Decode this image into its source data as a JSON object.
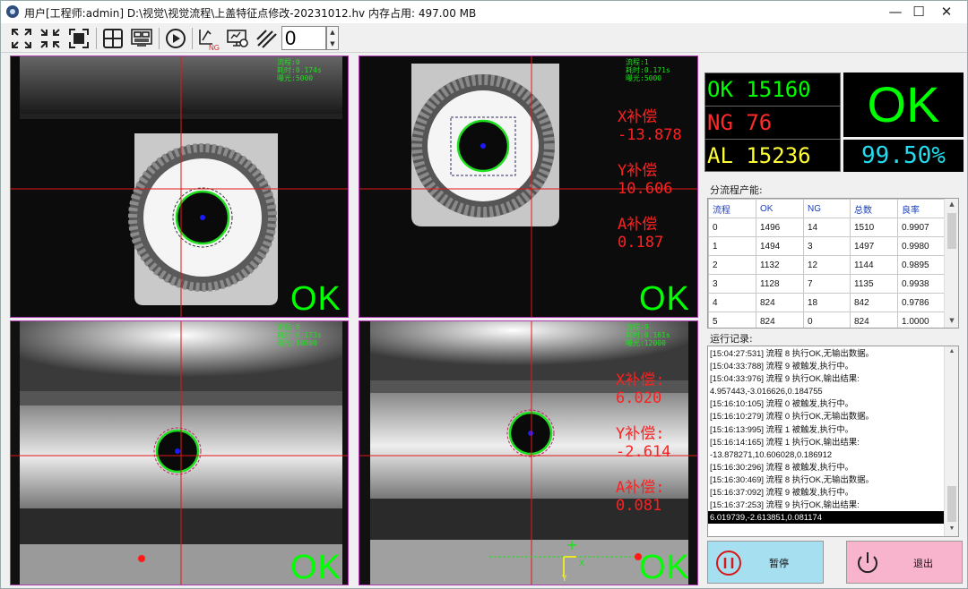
{
  "window": {
    "title": "用户[工程师:admin]  D:\\视觉\\视觉流程\\上盖特征点修改-20231012.hv 内存占用: 497.00 MB",
    "minimize": "—",
    "maximize": "☐",
    "close": "✕"
  },
  "toolbar": {
    "counter_value": "0",
    "icons": [
      "fit-all-icon",
      "shrink-icon",
      "fit-window-icon",
      "crosshair-icon",
      "camera-layout-icon",
      "run-icon",
      "ng-icon",
      "monitor-settings-icon",
      "slash-tool-icon"
    ],
    "ng_label": "NG"
  },
  "cameras": [
    {
      "info": "流程:0\n耗时:0.174s\n曝光:5000",
      "result": "OK"
    },
    {
      "info": "流程:1\n耗时:0.171s\n曝光:5000",
      "result": "OK",
      "comp": "X补偿\n-13.878\n\nY补偿\n10.606\n\nA补偿\n0.187"
    },
    {
      "info": "流程:8\n耗时:0.173s\n曝光:10000",
      "result": "OK"
    },
    {
      "info": "流程:9\n耗时:0.161s\n曝光:12000",
      "result": "OK",
      "comp": "X补偿:\n6.020\n\nY补偿:\n-2.614\n\nA补偿:\n0.081",
      "axis_x": "X",
      "axis_y": "Y"
    }
  ],
  "stats": {
    "ok_text": "OK 15160",
    "ng_text": "NG 76",
    "all_text": "AL 15236",
    "result": "OK",
    "yield": "99.50%",
    "colors": {
      "ok": "#00ff00",
      "ng": "#ff2a2a",
      "all": "#ffff33",
      "yield": "#22ddee"
    }
  },
  "flow_table": {
    "label": "分流程产能:",
    "headers": [
      "流程",
      "OK",
      "NG",
      "总数",
      "良率"
    ],
    "rows": [
      [
        "0",
        "1496",
        "14",
        "1510",
        "0.9907"
      ],
      [
        "1",
        "1494",
        "3",
        "1497",
        "0.9980"
      ],
      [
        "2",
        "1132",
        "12",
        "1144",
        "0.9895"
      ],
      [
        "3",
        "1128",
        "7",
        "1135",
        "0.9938"
      ],
      [
        "4",
        "824",
        "18",
        "842",
        "0.9786"
      ],
      [
        "5",
        "824",
        "0",
        "824",
        "1.0000"
      ]
    ]
  },
  "log": {
    "label": "运行记录:",
    "lines": [
      "[15:04:27:531] 流程 8 执行OK,无输出数据。",
      "[15:04:33:788] 流程 9 被触发,执行中。",
      "[15:04:33:976] 流程 9 执行OK,输出结果:",
      "4.957443,-3.016626,0.184755",
      "[15:16:10:105] 流程 0 被触发,执行中。",
      "[15:16:10:279] 流程 0 执行OK,无输出数据。",
      "[15:16:13:995] 流程 1 被触发,执行中。",
      "[15:16:14:165] 流程 1 执行OK,输出结果:",
      "-13.878271,10.606028,0.186912",
      "[15:16:30:296] 流程 8 被触发,执行中。",
      "[15:16:30:469] 流程 8 执行OK,无输出数据。",
      "[15:16:37:092] 流程 9 被触发,执行中。",
      "[15:16:37:253] 流程 9 执行OK,输出结果:",
      "6.019739,-2.613851,0.081174"
    ]
  },
  "buttons": {
    "pause": "暂停",
    "exit": "退出"
  }
}
